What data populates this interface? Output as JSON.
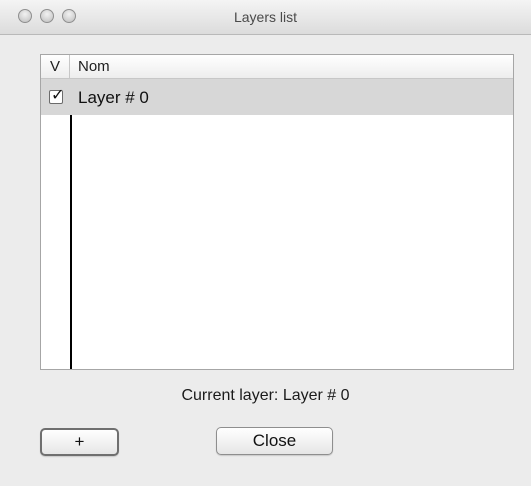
{
  "window": {
    "title": "Layers list"
  },
  "table": {
    "columns": [
      "V",
      "Nom"
    ],
    "rows": [
      {
        "visible": true,
        "name": "Layer # 0",
        "check_glyph": "✓"
      }
    ]
  },
  "status": {
    "current_layer_text": "Current layer: Layer # 0"
  },
  "buttons": {
    "add_label": "+",
    "close_label": "Close"
  },
  "icons": {
    "close": "traffic-light-close-icon",
    "minimize": "traffic-light-minimize-icon",
    "zoom": "traffic-light-zoom-icon"
  },
  "colors": {
    "window_bg": "#ececec",
    "selected_row": "#d7d7d7",
    "table_border": "#a6a6a6"
  }
}
